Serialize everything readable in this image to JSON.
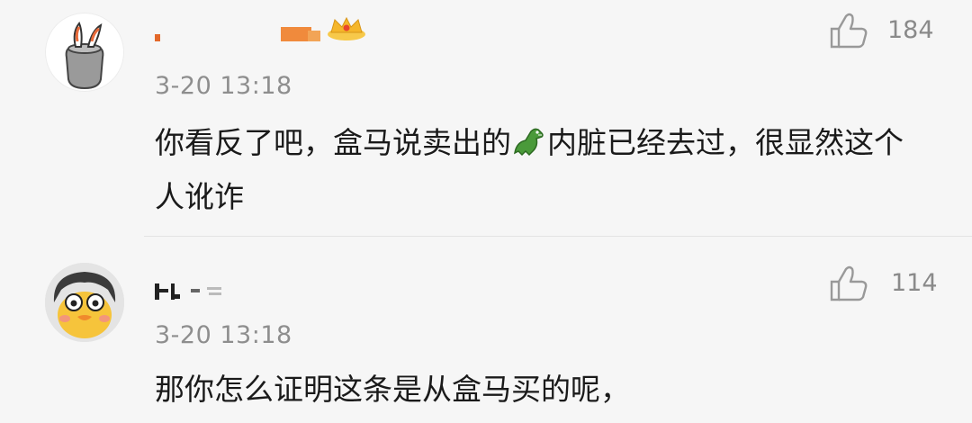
{
  "comments": [
    {
      "username": "",
      "time": "3-20 13:18",
      "text_before": "你看反了吧，盒马说卖出的",
      "emoji": "crocodile-emoji",
      "text_after": "内脏已经去过，很显然这个人讹诈",
      "likes": "184",
      "verified": true,
      "vip_badge": "crown-icon"
    },
    {
      "username": "",
      "time": "3-20 13:18",
      "text": "那你怎么证明这条是从盒马买的呢，",
      "likes": "114"
    }
  ],
  "colors": {
    "background": "#f6f6f6",
    "text": "#1a1a1a",
    "meta": "#8e8e8e",
    "verified_badge": "#f6b21b"
  }
}
